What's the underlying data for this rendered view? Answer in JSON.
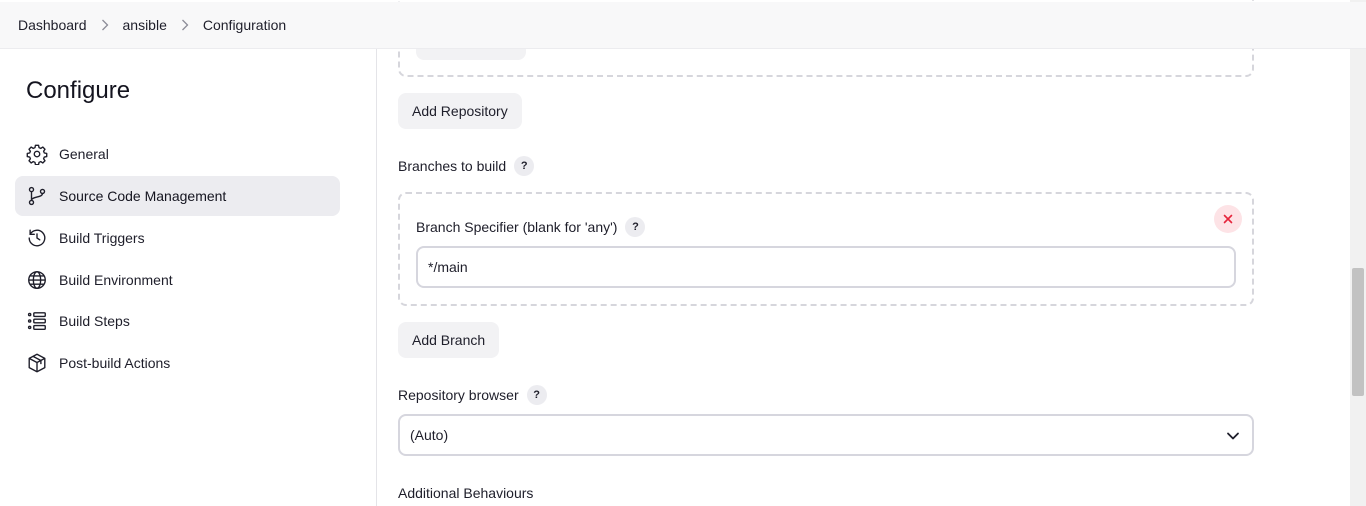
{
  "breadcrumb": [
    "Dashboard",
    "ansible",
    "Configuration"
  ],
  "sidebar": {
    "title": "Configure",
    "items": [
      {
        "label": "General",
        "icon": "gear-icon"
      },
      {
        "label": "Source Code Management",
        "icon": "branch-icon",
        "active": true
      },
      {
        "label": "Build Triggers",
        "icon": "clock-icon"
      },
      {
        "label": "Build Environment",
        "icon": "globe-icon"
      },
      {
        "label": "Build Steps",
        "icon": "list-icon"
      },
      {
        "label": "Post-build Actions",
        "icon": "package-icon"
      }
    ]
  },
  "main": {
    "add_repository_label": "Add Repository",
    "branches_label": "Branches to build",
    "branch_specifier_label": "Branch Specifier (blank for 'any')",
    "branch_specifier_value": "*/main",
    "add_branch_label": "Add Branch",
    "repository_browser_label": "Repository browser",
    "repository_browser_value": "(Auto)",
    "additional_behaviours_label": "Additional Behaviours",
    "help_symbol": "?"
  },
  "colors": {
    "active_bg": "#ececf0",
    "remove_bg": "#fde3e6",
    "remove_fg": "#e5253c"
  }
}
